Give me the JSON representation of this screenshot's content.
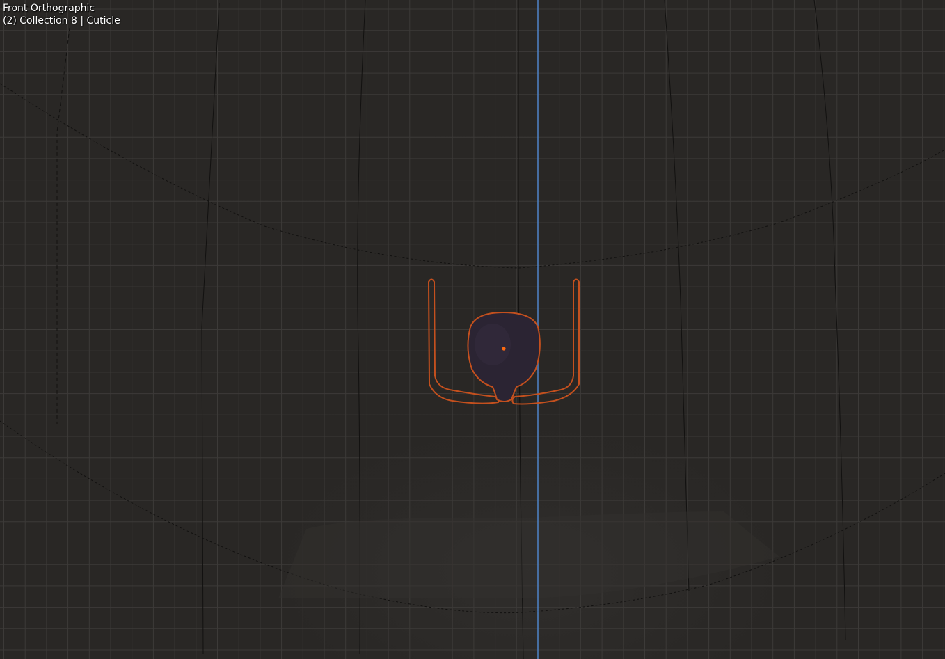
{
  "viewport": {
    "view_name": "Front Orthographic",
    "collection_info": "(2) Collection 8 | Cuticle"
  },
  "colors": {
    "background": "#292725",
    "grid_line": "#3c3a38",
    "z_axis": "#4d7fbf",
    "selection_outline": "#c4501e",
    "origin_dot": "#ff6a10",
    "mesh_fill": "#2b2433"
  },
  "icons": {
    "object_origin": "origin-dot-icon"
  }
}
